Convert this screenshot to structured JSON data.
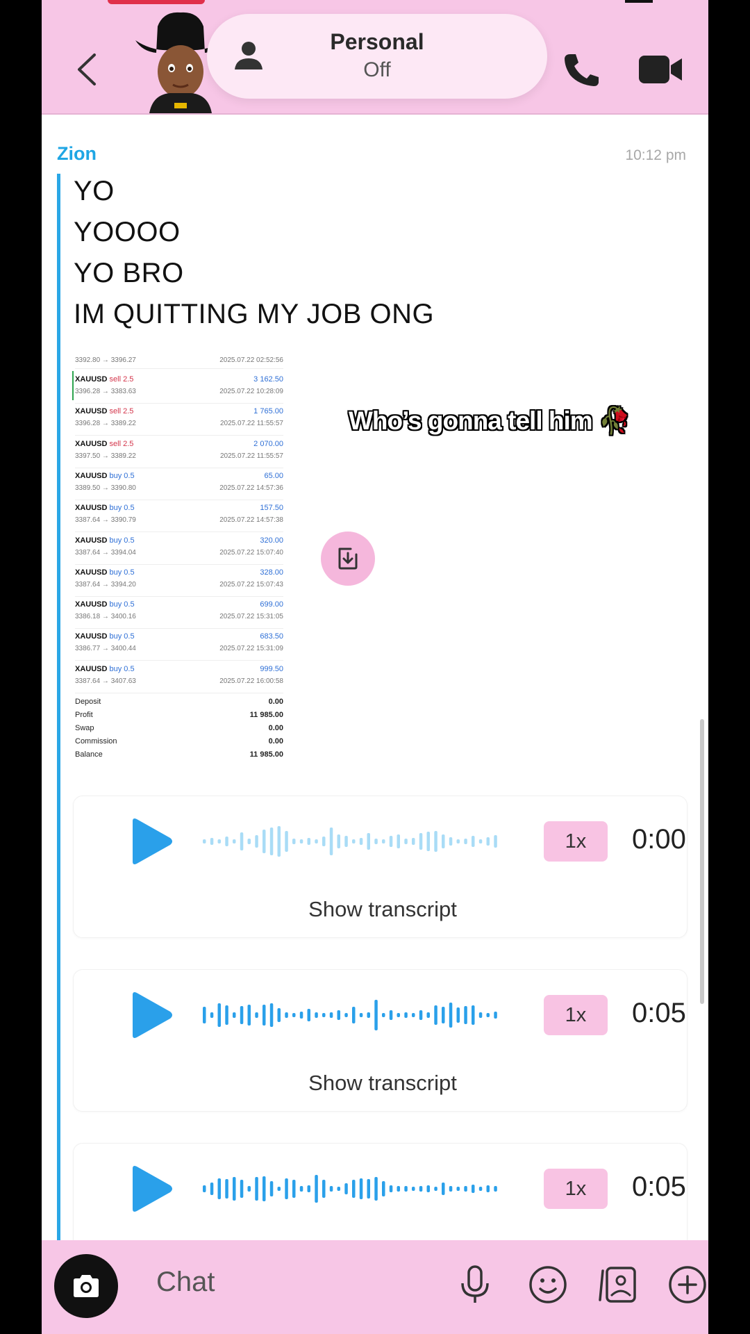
{
  "header": {
    "mode_title": "Personal",
    "mode_status": "Off",
    "colors": {
      "header_bg": "#f7c6e6",
      "accent": "#1fa6e4"
    }
  },
  "message": {
    "sender": "Zion",
    "time": "10:12 pm",
    "lines": [
      "YO",
      "YOOOO",
      "YO BRO",
      "IM QUITTING MY JOB ONG"
    ]
  },
  "trade_screenshot": {
    "top_range": "3392.80 → 3396.27",
    "top_date": "2025.07.22 02:52:56",
    "trades": [
      {
        "symbol": "XAUUSD",
        "side": "sell 2.5",
        "profit": "3 162.50",
        "range": "3396.28 → 3383.63",
        "date": "2025.07.22 10:28:09"
      },
      {
        "symbol": "XAUUSD",
        "side": "sell 2.5",
        "profit": "1 765.00",
        "range": "3396.28 → 3389.22",
        "date": "2025.07.22 11:55:57"
      },
      {
        "symbol": "XAUUSD",
        "side": "sell 2.5",
        "profit": "2 070.00",
        "range": "3397.50 → 3389.22",
        "date": "2025.07.22 11:55:57"
      },
      {
        "symbol": "XAUUSD",
        "side": "buy 0.5",
        "profit": "65.00",
        "range": "3389.50 → 3390.80",
        "date": "2025.07.22 14:57:36"
      },
      {
        "symbol": "XAUUSD",
        "side": "buy 0.5",
        "profit": "157.50",
        "range": "3387.64 → 3390.79",
        "date": "2025.07.22 14:57:38"
      },
      {
        "symbol": "XAUUSD",
        "side": "buy 0.5",
        "profit": "320.00",
        "range": "3387.64 → 3394.04",
        "date": "2025.07.22 15:07:40"
      },
      {
        "symbol": "XAUUSD",
        "side": "buy 0.5",
        "profit": "328.00",
        "range": "3387.64 → 3394.20",
        "date": "2025.07.22 15:07:43"
      },
      {
        "symbol": "XAUUSD",
        "side": "buy 0.5",
        "profit": "699.00",
        "range": "3386.18 → 3400.16",
        "date": "2025.07.22 15:31:05"
      },
      {
        "symbol": "XAUUSD",
        "side": "buy 0.5",
        "profit": "683.50",
        "range": "3386.77 → 3400.44",
        "date": "2025.07.22 15:31:09"
      },
      {
        "symbol": "XAUUSD",
        "side": "buy 0.5",
        "profit": "999.50",
        "range": "3387.64 → 3407.63",
        "date": "2025.07.22 16:00:58"
      }
    ],
    "summary": [
      {
        "label": "Deposit",
        "value": "0.00"
      },
      {
        "label": "Profit",
        "value": "11 985.00"
      },
      {
        "label": "Swap",
        "value": "0.00"
      },
      {
        "label": "Commission",
        "value": "0.00"
      },
      {
        "label": "Balance",
        "value": "11 985.00"
      }
    ]
  },
  "overlay": {
    "text": "Who’s gonna tell him 🥀"
  },
  "voice_notes": [
    {
      "speed": "1x",
      "duration": "0:00",
      "transcript": "Show transcript",
      "played": false
    },
    {
      "speed": "1x",
      "duration": "0:05",
      "transcript": "Show transcript",
      "played": true
    },
    {
      "speed": "1x",
      "duration": "0:05",
      "transcript": "",
      "played": true
    }
  ],
  "bottom_bar": {
    "placeholder": "Chat"
  }
}
